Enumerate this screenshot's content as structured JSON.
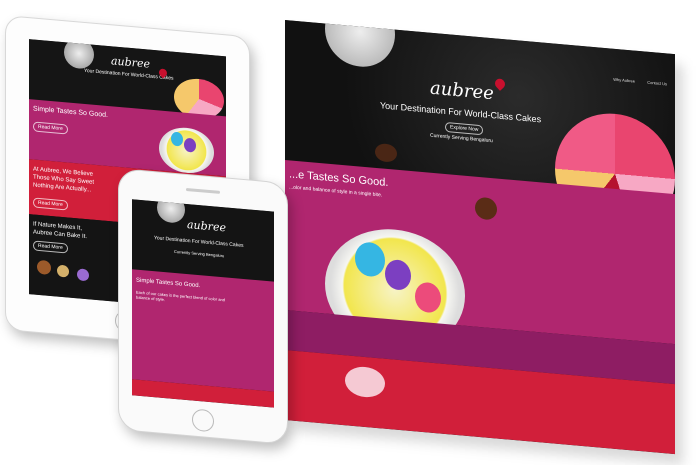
{
  "desktop": {
    "nav": {
      "about": "Why Aubree",
      "contact": "Contact Us"
    },
    "hero": {
      "logo": "aubree",
      "tagline": "Your Destination For World-Class Cakes",
      "button": "Explore Now",
      "subtext": "Currently Serving Bengaluru"
    },
    "section": {
      "heading": "...e Tastes So Good.",
      "body": "...olor and balance of style in a single bite."
    }
  },
  "tablet": {
    "hero": {
      "logo": "aubree",
      "tagline": "Your Destination For World-Class Cakes"
    },
    "section1": {
      "heading": "Simple Tastes So Good.",
      "button": "Read More"
    },
    "section2": {
      "line1": "At Aubree, We Believe",
      "line2": "Those Who Say Sweet",
      "line3": "Nothing Are Actually...",
      "button": "Read More"
    },
    "section3": {
      "line1": "If Nature Makes It,",
      "line2": "Aubree Can Bake It.",
      "button": "Read More"
    }
  },
  "phone": {
    "hero": {
      "logo": "aubree",
      "tagline": "Your Destination For World-Class Cakes",
      "subtext": "Currently Serving Bengaluru"
    },
    "section": {
      "heading": "Simple Tastes So Good.",
      "body": "Each of our cakes is the perfect blend of color and balance of style."
    }
  },
  "colors": {
    "pink": "#b0266f",
    "magenta": "#8e1d63",
    "red": "#d11f3a",
    "dark": "#141414"
  }
}
